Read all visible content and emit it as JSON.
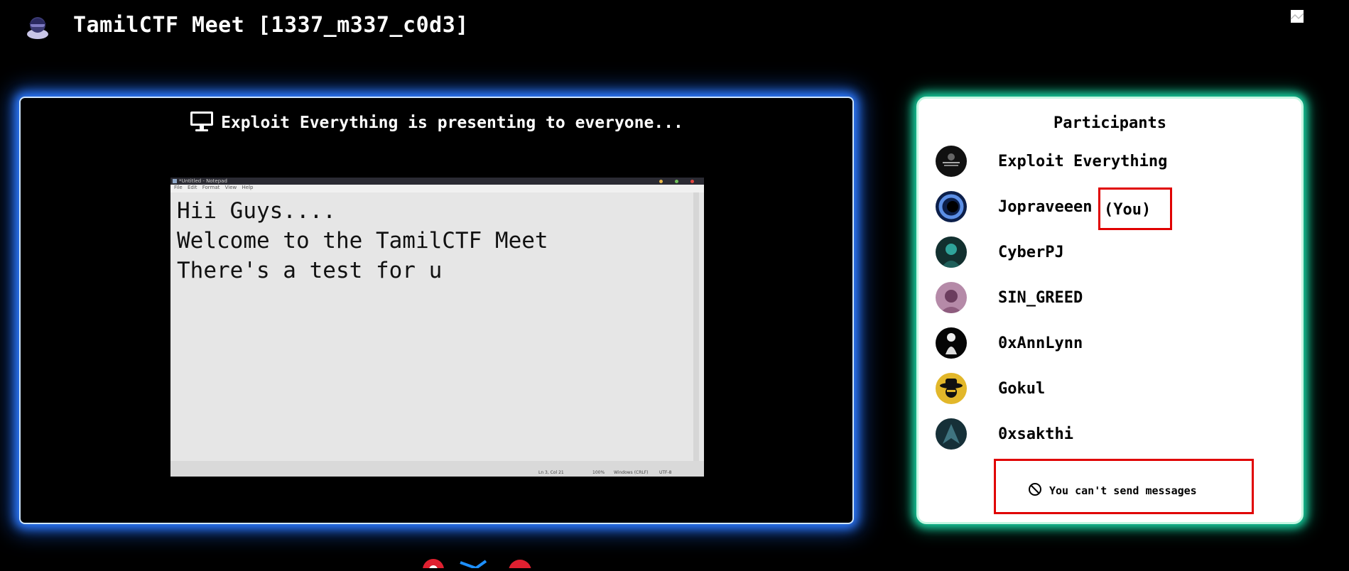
{
  "header": {
    "title": "TamilCTF Meet [1337_m337_c0d3]",
    "logo_icon": "hacker-icon"
  },
  "stage": {
    "presenting_text": "Exploit Everything is presenting to everyone...",
    "presenting_icon": "monitor-icon",
    "shared_screen": {
      "window_title": "*Untitled - Notepad",
      "menu": [
        "File",
        "Edit",
        "Format",
        "View",
        "Help"
      ],
      "text_lines": [
        "Hii Guys....",
        "Welcome to the TamilCTF Meet",
        "There's a test for u"
      ],
      "status": {
        "position": "Ln 3, Col 21",
        "zoom": "100%",
        "line_ending": "Windows (CRLF)",
        "encoding": "UTF-8"
      }
    }
  },
  "participants_panel": {
    "title": "Participants",
    "you_label": "(You)",
    "participants": [
      {
        "name": "Exploit Everything",
        "avatar_color": "#111111"
      },
      {
        "name": "Jopraveeen",
        "avatar_color": "#1b3f8f"
      },
      {
        "name": "CyberPJ",
        "avatar_color": "#1f6f6a"
      },
      {
        "name": "SIN_GREED",
        "avatar_color": "#8a5a82"
      },
      {
        "name": "0xAnnLynn",
        "avatar_color": "#050505"
      },
      {
        "name": "Gokul",
        "avatar_color": "#e2b72a"
      },
      {
        "name": "0xsakthi",
        "avatar_color": "#1f3a44"
      }
    ],
    "message_notice": "You can't send messages",
    "message_icon": "no-entry-icon"
  },
  "colors": {
    "background": "#000000",
    "stage_glow": "#2f7bff",
    "panel_glow": "#18d1a0",
    "highlight_box": "#e00000"
  }
}
